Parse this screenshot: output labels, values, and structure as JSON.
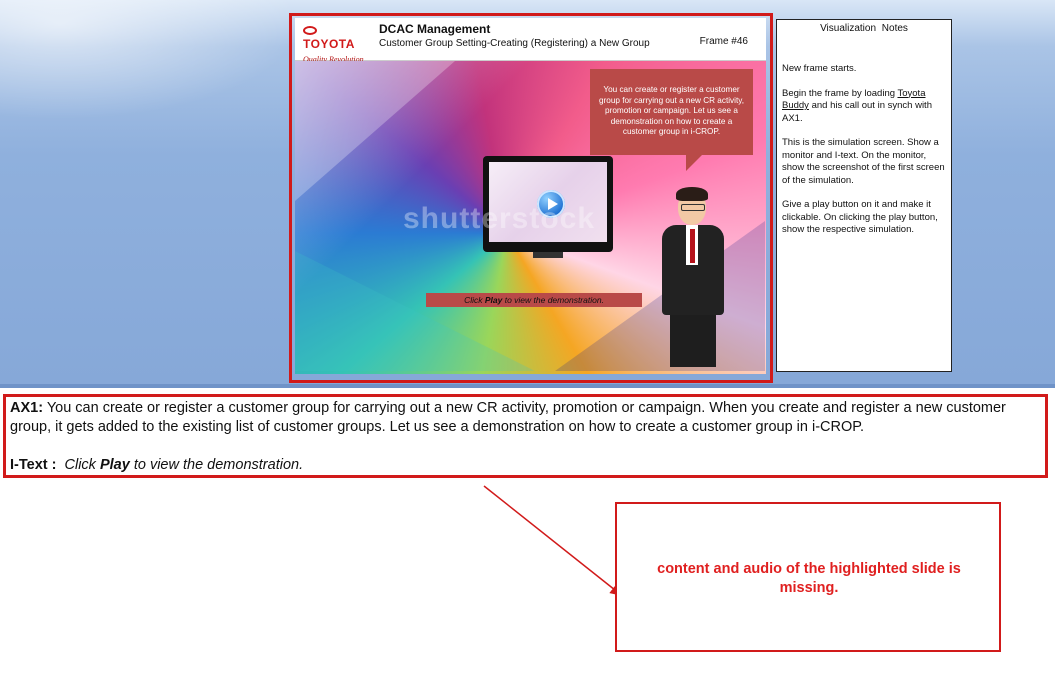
{
  "slide": {
    "logo_brand": "TOYOTA",
    "logo_tagline": "Quality Revolution",
    "module_title": "DCAC Management",
    "lesson_title": "Customer Group Setting-Creating (Registering) a New Group",
    "frame_number": "Frame #46",
    "callout_text": "You can create or register a customer group for carrying out a new CR activity, promotion or campaign. Let us see a demonstration on how to create a customer group in i-CROP.",
    "watermark": "shutterstock",
    "itext_prefix": "Click ",
    "itext_bold": "Play",
    "itext_suffix": " to view the demonstration."
  },
  "notes": {
    "title": "Visualization  Notes",
    "p1": "New frame starts.",
    "p2_a": "Begin the frame  by loading ",
    "p2_link": "Toyota Buddy",
    "p2_b": " and his call out in synch with AX1.",
    "p3": "This is the simulation screen. Show a monitor and I-text. On the monitor, show the screenshot of the first screen of the simulation.",
    "p4": "Give a play button on it and make it clickable. On clicking the play button, show the respective simulation."
  },
  "script": {
    "ax1_label": "AX1:",
    "ax1_text": " You can create or register a customer group for carrying out a new CR activity, promotion or campaign. When you create and register a new customer group, it gets added to the existing list of customer groups. Let us see a demonstration on how to create a customer group in i-CROP.",
    "itext_label": "I-Text :",
    "itext_a": "Click ",
    "itext_b": "Play",
    "itext_c": " to view the demonstration."
  },
  "review_comment": "content and audio of the highlighted slide is missing.",
  "colors": {
    "highlight_red": "#d11a1a",
    "callout_red": "#b94a48",
    "comment_text": "#e02020"
  }
}
